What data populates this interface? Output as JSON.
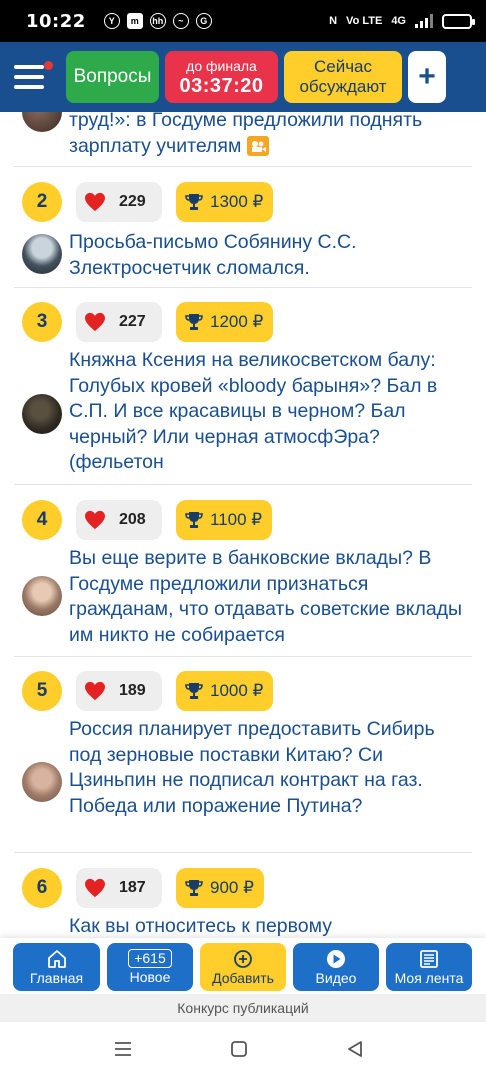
{
  "status_bar": {
    "time": "10:22",
    "left_icons": [
      "Y",
      "m",
      "hh",
      "~",
      "G"
    ],
    "right_text": [
      "N",
      "Vo LTE",
      "4G"
    ],
    "battery_fraction": 0.8
  },
  "header": {
    "questions_label": "Вопросы",
    "final_label": "до финала",
    "final_timer": "03:37:20",
    "discuss_label_line1": "Сейчас",
    "discuss_label_line2": "обсуждают",
    "plus_label": "+"
  },
  "feed": {
    "top_partial": {
      "title": "труд!»: в Госдуме предложили поднять зарплату учителям"
    },
    "items": [
      {
        "rank": "2",
        "likes": "229",
        "prize": "1300 ₽",
        "title": "Просьба-письмо Собянину С.С. Злектросчетчик сломался."
      },
      {
        "rank": "3",
        "likes": "227",
        "prize": "1200 ₽",
        "title": "Княжна Ксения на великосветском балу: Голубых кровей «bloody барыня»? Бал в С.П. И все красавицы в черном? Бал черный? Или черная атмосфЭра? (фельетон"
      },
      {
        "rank": "4",
        "likes": "208",
        "prize": "1100 ₽",
        "title": "Вы еще верите в банковские вклады? В Госдуме предложили признаться гражданам, что отдавать советские вклады им никто не собирается"
      },
      {
        "rank": "5",
        "likes": "189",
        "prize": "1000 ₽",
        "title": "Россия планирует предоставить Сибирь под зерновые поставки Китаю? Си Цзиньпин не подписал контракт на газ. Победа или поражение Путина?"
      },
      {
        "rank": "6",
        "likes": "187",
        "prize": "900 ₽",
        "title": "Как вы относитесь к первому"
      }
    ]
  },
  "bottom_nav": {
    "home": "Главная",
    "new_count": "+615",
    "new": "Новое",
    "add": "Добавить",
    "video": "Видео",
    "feed": "Моя лента"
  },
  "contest": "Конкурс публикаций",
  "colors": {
    "header_bg": "#1a4f8f",
    "questions_green": "#2faa4a",
    "final_red": "#e8334a",
    "accent_yellow": "#ffce2a",
    "nav_blue": "#1e6fc8",
    "title_blue": "#1a4f8f",
    "heart_red": "#e52222"
  }
}
